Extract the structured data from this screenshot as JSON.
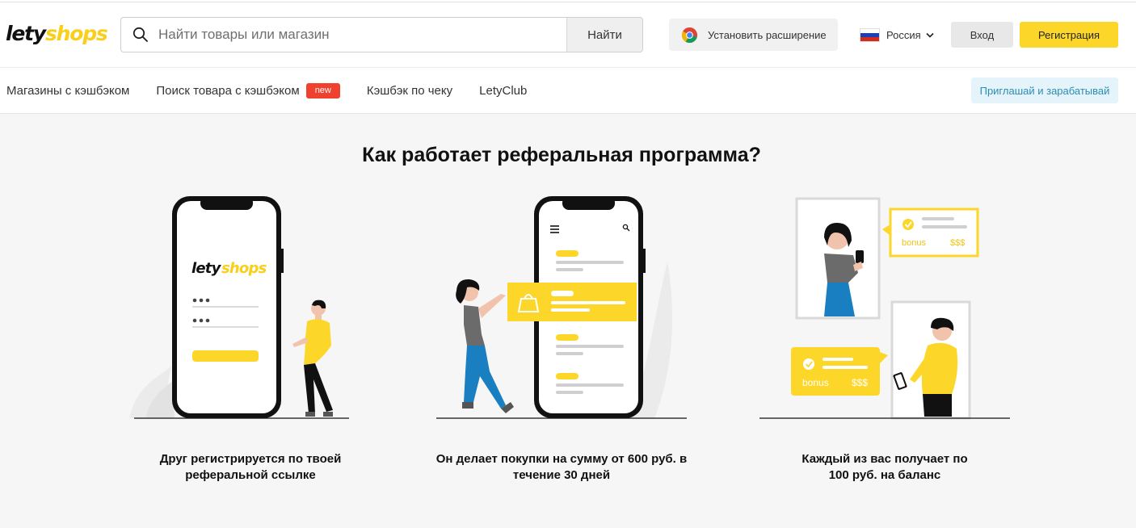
{
  "header": {
    "logo_part1": "lety",
    "logo_part2": "shops",
    "search": {
      "placeholder": "Найти товары или магазин",
      "button": "Найти"
    },
    "extension_button": "Установить расширение",
    "region": "Россия",
    "login": "Вход",
    "register": "Регистрация"
  },
  "nav": {
    "items": [
      {
        "label": "Магазины с кэшбэком"
      },
      {
        "label": "Поиск товара с кэшбэком",
        "badge": "new"
      },
      {
        "label": "Кэшбэк по чеку"
      },
      {
        "label": "LetyClub"
      }
    ],
    "invite_button": "Приглашай и зарабатывай"
  },
  "main": {
    "title": "Как работает реферальная программа?",
    "steps": [
      {
        "line1": "Друг регистрируется по твоей",
        "line2": "реферальной ссылке"
      },
      {
        "line1": "Он делает покупки на сумму от 600 руб. в",
        "line2": "течение 30 дней"
      },
      {
        "line1": "Каждый из вас получает по",
        "line2": "100 руб. на баланс"
      }
    ],
    "phone_logo_part1": "lety",
    "phone_logo_part2": "shops",
    "bonus_label": "bonus",
    "bonus_value": "$$$"
  },
  "colors": {
    "brand_yellow": "#fcd72a",
    "new_badge": "#f0402e",
    "invite_text": "#2b8db1",
    "figure_blue": "#1a7fc1"
  }
}
